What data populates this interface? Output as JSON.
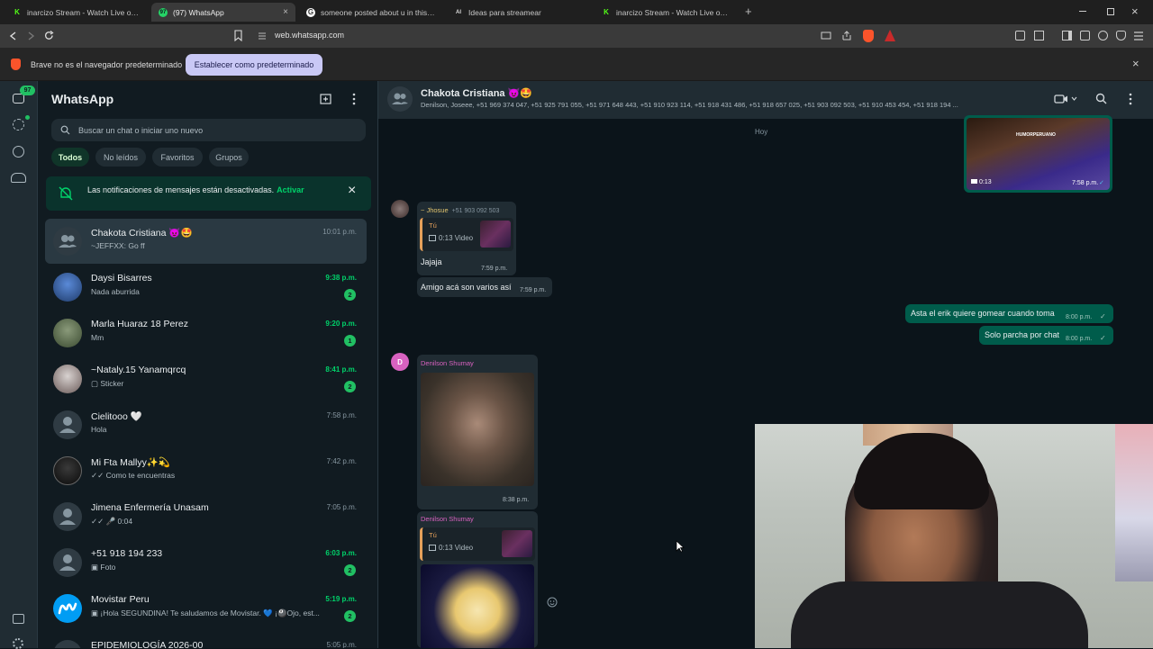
{
  "browser": {
    "tabs": [
      {
        "label": "inarcizo Stream - Watch Live on Kick",
        "fav": "K",
        "fav_color": "#53fc18"
      },
      {
        "label": "(97) WhatsApp",
        "fav": "97",
        "fav_color": "#25d366"
      },
      {
        "label": "someone posted about u in this disc",
        "fav": "G",
        "fav_color": "#ffffff"
      },
      {
        "label": "Ideas para streamear",
        "fav": "AI",
        "fav_color": "#dddddd"
      },
      {
        "label": "inarcizo Stream - Watch Live on Kick",
        "fav": "K",
        "fav_color": "#53fc18"
      }
    ],
    "close_glyph": "×",
    "new_tab_glyph": "+",
    "url": "web.whatsapp.com",
    "infobar_text": "Brave no es el navegador predeterminado",
    "infobar_button": "Establecer como predeterminado",
    "infobar_close": "×"
  },
  "rail": {
    "unread_badge": "97"
  },
  "sidebar": {
    "title": "WhatsApp",
    "search_placeholder": "Buscar un chat o iniciar uno nuevo",
    "filters": [
      "Todos",
      "No leídos",
      "Favoritos",
      "Grupos"
    ],
    "notification_text": "Las notificaciones de mensajes están desactivadas.",
    "notification_link": "Activar",
    "notification_close": "×",
    "chats": [
      {
        "name": "Chakota Cristiana 😈🤩",
        "last": "~JEFFXX: Go ff",
        "time": "10:01 p.m.",
        "unread": ""
      },
      {
        "name": "Daysi Bisarres",
        "last": "Nada aburrida",
        "time": "9:38 p.m.",
        "unread": "2"
      },
      {
        "name": "Marla Huaraz 18 Perez",
        "last": "Mm",
        "time": "9:20 p.m.",
        "unread": "1"
      },
      {
        "name": "~Nataly.15 Yanamqrcq",
        "last": "▢ Sticker",
        "time": "8:41 p.m.",
        "unread": "2"
      },
      {
        "name": "Cielitooo 🤍",
        "last": "Hola",
        "time": "7:58 p.m.",
        "unread": ""
      },
      {
        "name": "Mi Fta Mallyy✨💫",
        "last": "✓✓ Como te encuentras",
        "time": "7:42 p.m.",
        "unread": ""
      },
      {
        "name": "Jimena Enfermería Unasam",
        "last": "✓✓ 🎤 0:04",
        "time": "7:05 p.m.",
        "unread": ""
      },
      {
        "name": "+51 918 194 233",
        "last": "▣ Foto",
        "time": "6:03 p.m.",
        "unread": "2"
      },
      {
        "name": "Movistar Peru",
        "last": "▣ ¡Hola SEGUNDINA! Te saludamos de Movistar. 💙 ¡🎱Ojo, est...",
        "time": "5:19 p.m.",
        "unread": "2"
      },
      {
        "name": "EPIDEMIOLOGÍA 2026-00",
        "last": "",
        "time": "5:05 p.m.",
        "unread": ""
      }
    ]
  },
  "conversation": {
    "name": "Chakota Cristiana 😈🤩",
    "members": "Denilson, Joseee, +51 969 374 047, +51 925 791 055, +51 971 648 443, +51 910 923 114, +51 918 431 486, +51 918 657 025, +51 903 092 503, +51 910 453 454, +51 918 194 ...",
    "day_label": "Hoy",
    "video_in_top": {
      "duration": "0:13",
      "time": "7:58 p.m.",
      "caption": "HUMORPERUANO"
    },
    "msg_jhosue": {
      "sender": "~ Jhosue",
      "phone": "+51 903 092 503",
      "quote_who": "Tú",
      "quote_what": "0:13 Video",
      "text": "Jajaja",
      "time": "7:59 p.m."
    },
    "msg_amigo": {
      "text": "Amigo acá son varios así",
      "time": "7:59 p.m."
    },
    "out1": {
      "text": "Asta el erik quiere gomear cuando toma",
      "time": "8:00 p.m."
    },
    "out2": {
      "text": "Solo parcha por chat",
      "time": "8:00 p.m."
    },
    "msg_denilson1": {
      "sender": "Denilson Shumay",
      "avatar_letter": "D",
      "time": "8:38 p.m."
    },
    "msg_denilson2": {
      "sender": "Denilson Shumay",
      "quote_who": "Tú",
      "quote_what": "0:13 Video"
    }
  }
}
